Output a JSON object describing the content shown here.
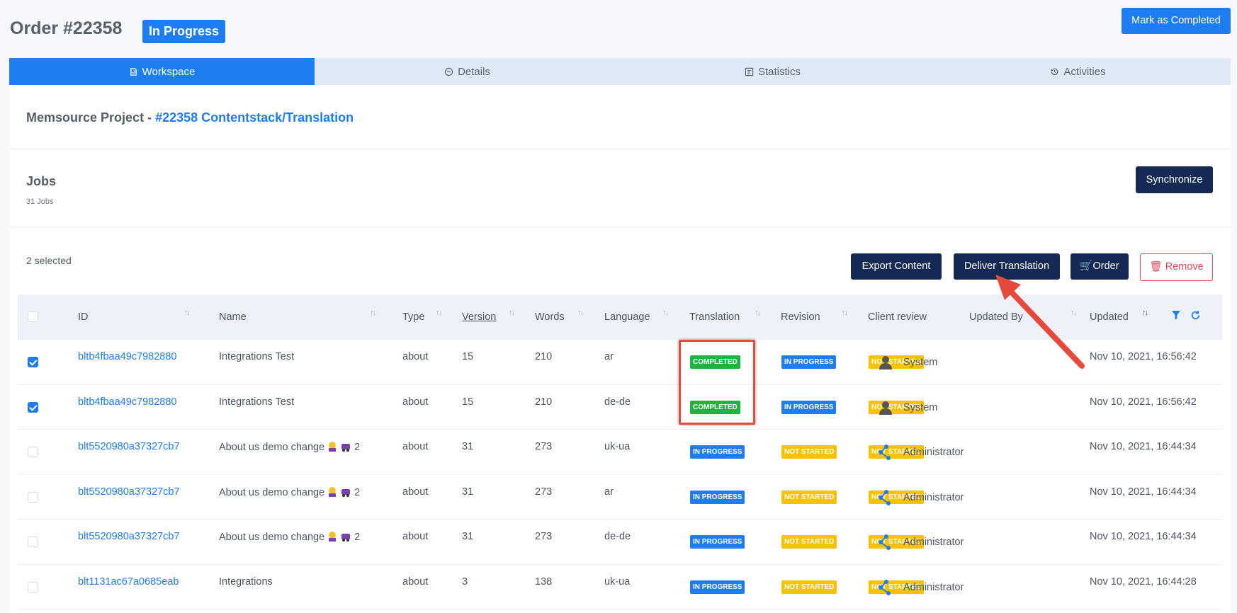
{
  "header": {
    "order_title": "Order #22358",
    "status": "In Progress",
    "mark_completed": "Mark as Completed"
  },
  "tabs": [
    {
      "label": "Workspace",
      "icon": "refresh-doc-icon",
      "active": true
    },
    {
      "label": "Details",
      "icon": "info-circle-icon",
      "active": false
    },
    {
      "label": "Statistics",
      "icon": "bar-list-icon",
      "active": false
    },
    {
      "label": "Activities",
      "icon": "history-icon",
      "active": false
    }
  ],
  "project": {
    "prefix": "Memsource Project - ",
    "link": "#22358 Contentstack/Translation"
  },
  "jobs": {
    "title": "Jobs",
    "count": "31 Jobs",
    "synchronize": "Synchronize"
  },
  "actions": {
    "selected": "2 selected",
    "export": "Export Content",
    "deliver": "Deliver Translation",
    "order": "Order",
    "remove": "Remove"
  },
  "table": {
    "headers": {
      "id": "ID",
      "name": "Name",
      "type": "Type",
      "version": "Version",
      "words": "Words",
      "language": "Language",
      "translation": "Translation",
      "revision": "Revision",
      "client_review": "Client review",
      "updated_by": "Updated By",
      "updated": "Updated"
    },
    "rows": [
      {
        "checked": true,
        "id": "bltb4fbaa49c7982880",
        "name": "Integrations Test",
        "emoji": false,
        "type": "about",
        "version": "15",
        "words": "210",
        "language": "ar",
        "translation": "COMPLETED",
        "revision": "IN PROGRESS",
        "client_review": "NOT STARTED",
        "updated_by": "System",
        "updated": "Nov 10, 2021, 16:56:42"
      },
      {
        "checked": true,
        "id": "bltb4fbaa49c7982880",
        "name": "Integrations Test",
        "emoji": false,
        "type": "about",
        "version": "15",
        "words": "210",
        "language": "de-de",
        "translation": "COMPLETED",
        "revision": "IN PROGRESS",
        "client_review": "NOT STARTED",
        "updated_by": "System",
        "updated": "Nov 10, 2021, 16:56:42"
      },
      {
        "checked": false,
        "id": "blt5520980a37327cb7",
        "name": "About us demo change",
        "emoji": true,
        "emoji_suffix": "2",
        "type": "about",
        "version": "31",
        "words": "273",
        "language": "uk-ua",
        "translation": "IN PROGRESS",
        "revision": "NOT STARTED",
        "client_review": "NOT STARTED",
        "updated_by": "Administrator",
        "updated": "Nov 10, 2021, 16:44:34"
      },
      {
        "checked": false,
        "id": "blt5520980a37327cb7",
        "name": "About us demo change",
        "emoji": true,
        "emoji_suffix": "2",
        "type": "about",
        "version": "31",
        "words": "273",
        "language": "ar",
        "translation": "IN PROGRESS",
        "revision": "NOT STARTED",
        "client_review": "NOT STARTED",
        "updated_by": "Administrator",
        "updated": "Nov 10, 2021, 16:44:34"
      },
      {
        "checked": false,
        "id": "blt5520980a37327cb7",
        "name": "About us demo change",
        "emoji": true,
        "emoji_suffix": "2",
        "type": "about",
        "version": "31",
        "words": "273",
        "language": "de-de",
        "translation": "IN PROGRESS",
        "revision": "NOT STARTED",
        "client_review": "NOT STARTED",
        "updated_by": "Administrator",
        "updated": "Nov 10, 2021, 16:44:34"
      },
      {
        "checked": false,
        "id": "blt1131ac67a0685eab",
        "name": "Integrations",
        "emoji": false,
        "type": "about",
        "version": "3",
        "words": "138",
        "language": "uk-ua",
        "translation": "IN PROGRESS",
        "revision": "NOT STARTED",
        "client_review": "NOT STARTED",
        "updated_by": "Administrator",
        "updated": "Nov 10, 2021, 16:44:28"
      }
    ]
  },
  "colors": {
    "primary": "#1e7df0",
    "navy": "#142a55",
    "completed": "#1fb341",
    "not_started": "#f8c200",
    "danger": "#e8475b",
    "annotation": "#e54a3d"
  }
}
